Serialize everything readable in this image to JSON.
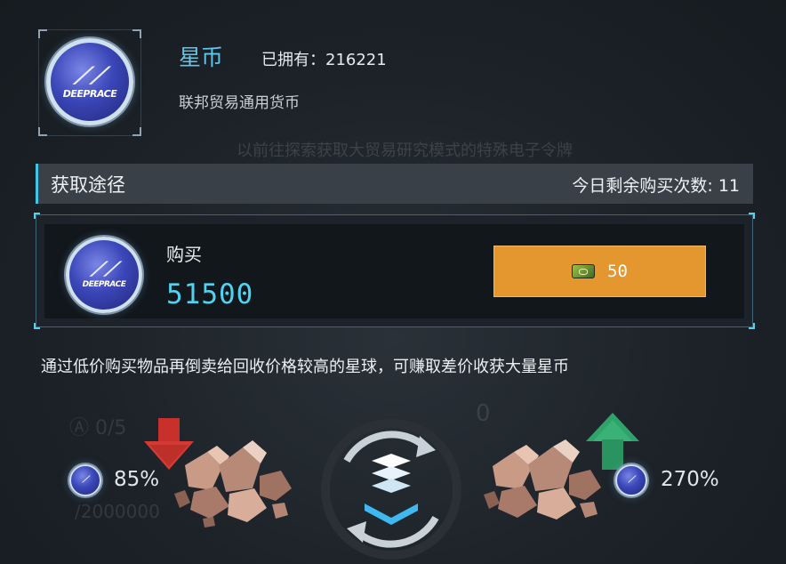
{
  "header": {
    "currency_name": "星币",
    "owned": "已拥有：216221",
    "description": "联邦贸易通用货币",
    "ghost_text": "以前往探索获取大贸易研究模式的特殊电子令牌",
    "coin_brand": "DEEPRACE"
  },
  "route": {
    "label": "获取途径",
    "daily_remaining": "今日剩余购买次数: 11"
  },
  "buy": {
    "label": "购买",
    "amount": "51500",
    "price": "50",
    "price_icon": "ticket-icon"
  },
  "tip": "通过低价购买物品再倒卖给回收价格较高的星球，可赚取差价收获大量星币",
  "exchange": {
    "buy_percent": "85%",
    "sell_percent": "270%",
    "faint_left_top": "Ⓐ 0/5",
    "faint_left_bottom": "/2000000",
    "faint_right_top": "0"
  },
  "colors": {
    "accent_cyan": "#4fd3f0",
    "button_orange": "#e4962f",
    "down_red": "#c8302b",
    "up_green": "#2fa36a"
  }
}
